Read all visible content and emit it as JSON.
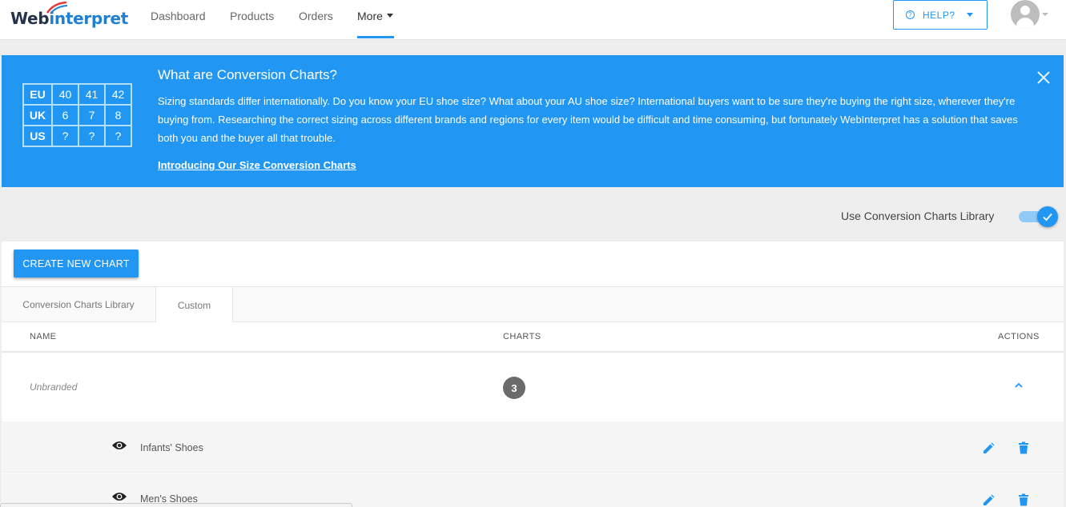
{
  "header": {
    "logo_text_dark": "Web",
    "logo_text_blue": "interpret",
    "nav": [
      {
        "label": "Dashboard"
      },
      {
        "label": "Products"
      },
      {
        "label": "Orders"
      },
      {
        "label": "More"
      }
    ],
    "help_label": "HELP?",
    "help_icon": "question-circle-icon",
    "avatar_icon": "user-avatar-icon"
  },
  "banner": {
    "title": "What are Conversion Charts?",
    "text": "Sizing standards differ internationally. Do you know your EU shoe size? What about your AU shoe size? International buyers want to be sure they're buying the right size, wherever they're buying from. Researching the correct sizing across different brands and regions for every item would be difficult and time consuming, but fortunately WebInterpret has a solution that saves both you and the buyer all that trouble.",
    "link": "Introducing Our Size Conversion Charts",
    "size_table": [
      [
        "EU",
        "40",
        "41",
        "42"
      ],
      [
        "UK",
        "6",
        "7",
        "8"
      ],
      [
        "US",
        "?",
        "?",
        "?"
      ]
    ],
    "background_color": "#2196f3"
  },
  "toggle": {
    "label": "Use Conversion Charts Library",
    "enabled": true
  },
  "main": {
    "create_button": "CREATE NEW CHART",
    "tabs": [
      {
        "label": "Conversion Charts Library",
        "active": false
      },
      {
        "label": "Custom",
        "active": true
      }
    ],
    "columns": {
      "name": "NAME",
      "charts": "CHARTS",
      "actions": "ACTIONS"
    },
    "group": {
      "name": "Unbranded",
      "count": "3",
      "expanded": true
    },
    "items": [
      {
        "name": "Infants' Shoes"
      },
      {
        "name": "Men's Shoes"
      }
    ]
  },
  "colors": {
    "accent": "#2196f3",
    "badge": "#6b6b6b"
  }
}
